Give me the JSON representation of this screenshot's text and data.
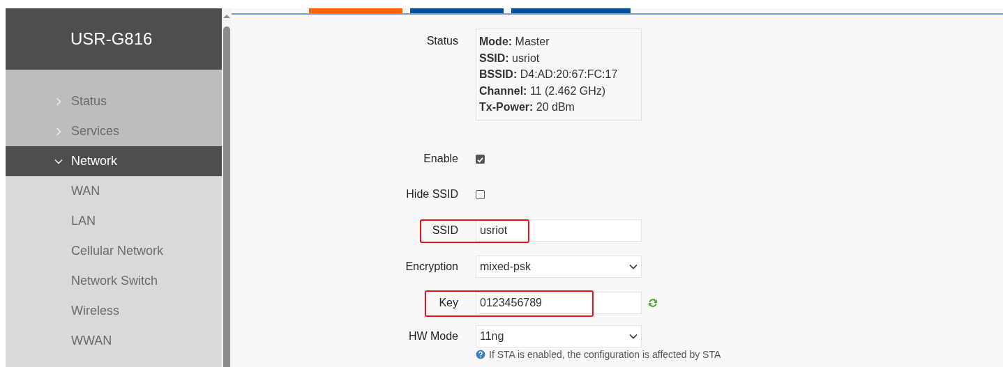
{
  "sidebar": {
    "title": "USR-G816",
    "items": [
      {
        "label": "Status",
        "expanded": false,
        "selected": false
      },
      {
        "label": "Services",
        "expanded": false,
        "selected": false
      },
      {
        "label": "Network",
        "expanded": true,
        "selected": true,
        "children": [
          {
            "label": "WAN"
          },
          {
            "label": "LAN"
          },
          {
            "label": "Cellular Network"
          },
          {
            "label": "Network Switch"
          },
          {
            "label": "Wireless"
          },
          {
            "label": "WWAN"
          }
        ]
      }
    ]
  },
  "tabs": [
    {
      "selected": true
    },
    {
      "selected": false
    },
    {
      "selected": false
    }
  ],
  "form": [
    {
      "kind": "status",
      "label": "Status",
      "lines": [
        "**Mode:** Master",
        "**SSID:** usriot",
        "**BSSID:** D4:AD:20:67:FC:17",
        "**Channel:** 11 (2.462 GHz)",
        "**Tx-Power:** 20 dBm"
      ]
    },
    {
      "kind": "checkbox",
      "label": "Enable",
      "checked": true
    },
    {
      "kind": "checkbox",
      "label": "Hide SSID",
      "checked": false
    },
    {
      "kind": "text",
      "label": "SSID",
      "value": "usriot",
      "highlighted": true
    },
    {
      "kind": "select",
      "label": "Encryption",
      "value": "mixed-psk"
    },
    {
      "kind": "key",
      "label": "Key",
      "value": "0123456789",
      "highlighted": true
    },
    {
      "kind": "select",
      "label": "HW Mode",
      "value": "11ng",
      "hint": "If STA is enabled, the configuration is affected by STA"
    }
  ]
}
